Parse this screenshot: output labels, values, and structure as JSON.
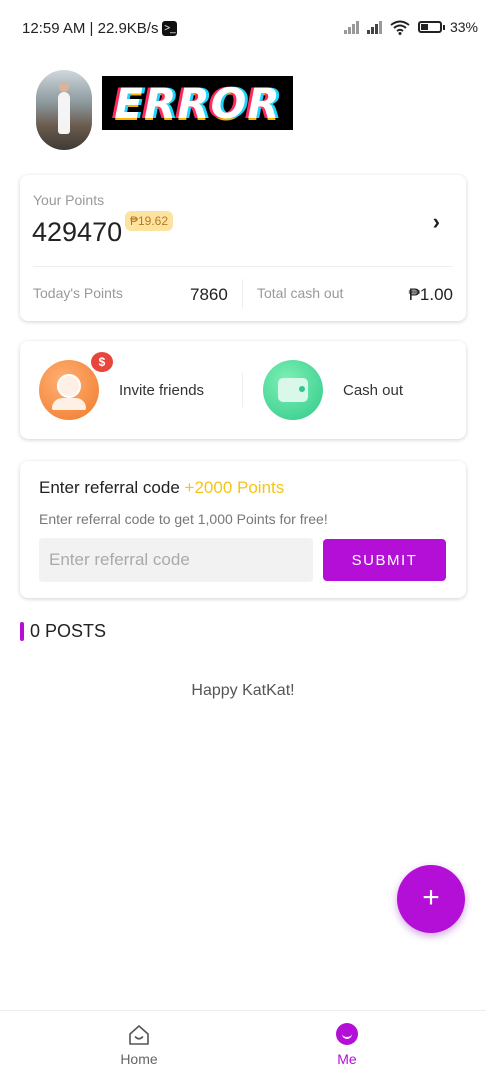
{
  "status_bar": {
    "time_speed": "12:59 AM | 22.9KB/s",
    "battery": "33",
    "battery_level": 0.33
  },
  "profile": {
    "username": "ERROR"
  },
  "points_card": {
    "your_points_label": "Your Points",
    "points_value": "429470",
    "peso_badge": "₱19.62",
    "today_label": "Today's Points",
    "today_value": "7860",
    "cash_label": "Total cash out",
    "cash_value": "₱1.00"
  },
  "actions": {
    "invite_label": "Invite friends",
    "cashout_label": "Cash out"
  },
  "referral": {
    "title": "Enter referral code",
    "bonus": "+2000 Points",
    "subtitle": "Enter referral code to get 1,000 Points for free!",
    "input_placeholder": "Enter referral code",
    "input_value": "",
    "submit_label": "SUBMIT"
  },
  "posts": {
    "heading": "0 POSTS",
    "empty_message": "Happy KatKat!"
  },
  "fab": {
    "label": "+"
  },
  "nav": {
    "home_label": "Home",
    "me_label": "Me"
  },
  "colors": {
    "accent": "#b40fd6",
    "bonus": "#f5c518",
    "invite": "#f07a2a",
    "cashout": "#2fc98a"
  },
  "icons": [
    "terminal-icon",
    "signal-icon",
    "wifi-icon",
    "battery-icon",
    "chevron-right-icon",
    "invite-icon",
    "dollar-badge-icon",
    "wallet-icon",
    "plus-icon",
    "home-icon",
    "me-icon"
  ]
}
